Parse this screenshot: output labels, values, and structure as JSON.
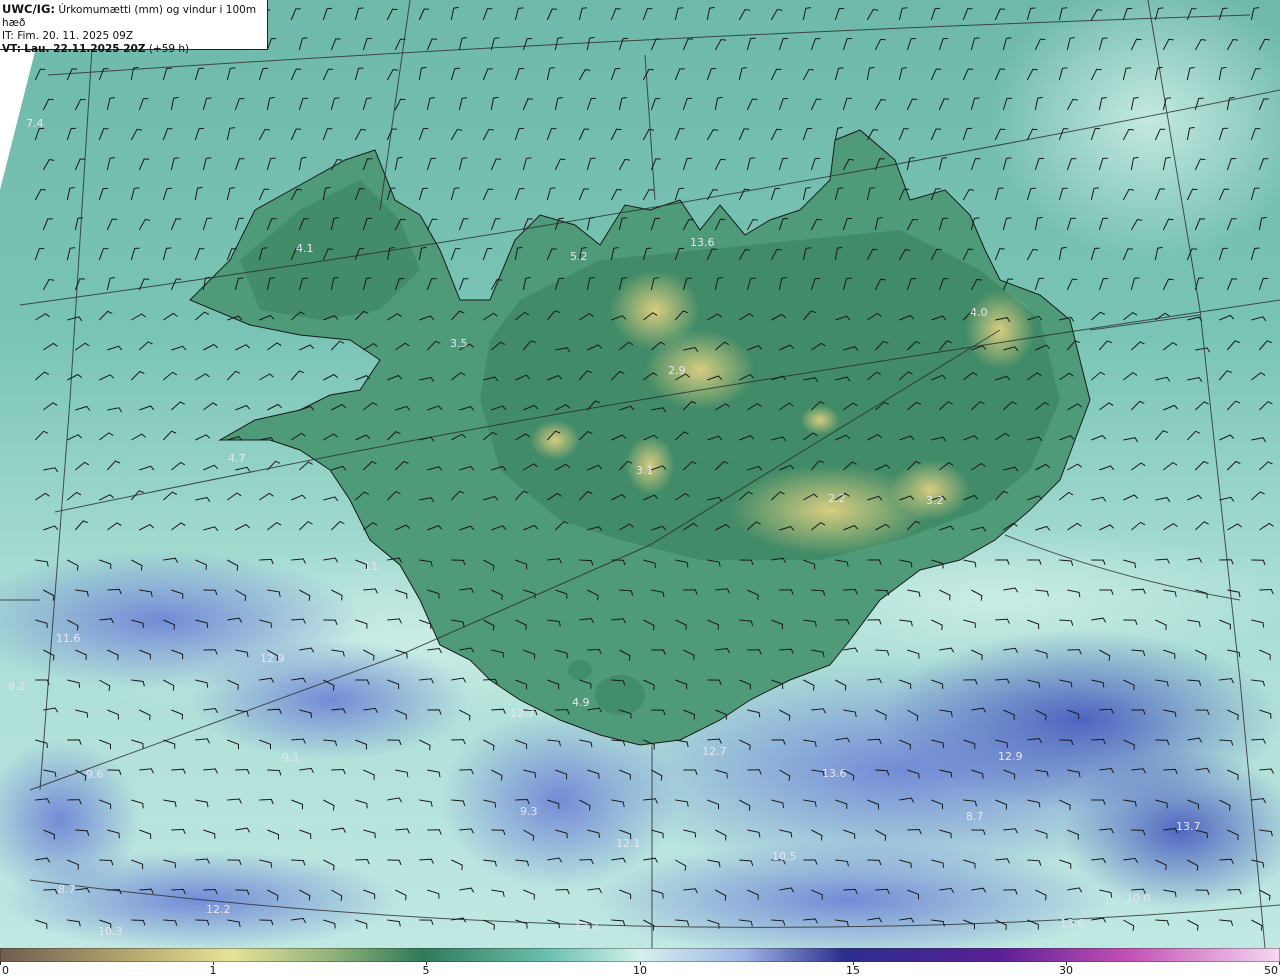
{
  "header": {
    "product": "UWC/IG:",
    "description": "Úrkomumætti (mm) og vindur i 100m hæð",
    "init_time": "IT: Fim. 20. 11. 2025 09Z",
    "valid_prefix": "VT:",
    "valid_time": "Lau. 22.11.2025 20Z",
    "lead": "(+59 h)"
  },
  "colorbar": {
    "ticks": [
      "0",
      "1",
      "5",
      "10",
      "15",
      "30",
      "50"
    ],
    "colors": [
      "#7a6a55",
      "#c9c178",
      "#e9e79a",
      "#3f8a66",
      "#7fd0c0",
      "#cdeee8",
      "#a9c3e9",
      "#5a6fc4",
      "#1f1f8a",
      "#4b1a90",
      "#c04db0",
      "#f0b0e8"
    ]
  },
  "map": {
    "ocean_colors": {
      "land_green": "#3f8a66",
      "highland_yellow": "#c9c37a",
      "sea_teal": "#8fd4c8",
      "rain_blue": "#6f86d6"
    },
    "value_labels": [
      "4.1",
      "5.2",
      "3.5",
      "2.9",
      "4.0",
      "7.4",
      "4.7",
      "3.1",
      "2.2",
      "3.2",
      "11",
      "12.7",
      "9.2",
      "12.9",
      "13.6",
      "13.7",
      "4.9",
      "13.6",
      "12.7",
      "12.1",
      "10.5",
      "12.2",
      "10.3",
      "9.6",
      "8.7",
      "12.9",
      "8.7",
      "12.2",
      "11.6",
      "9.3",
      "9.1",
      "13.6",
      "10.0"
    ],
    "place_labels": []
  }
}
